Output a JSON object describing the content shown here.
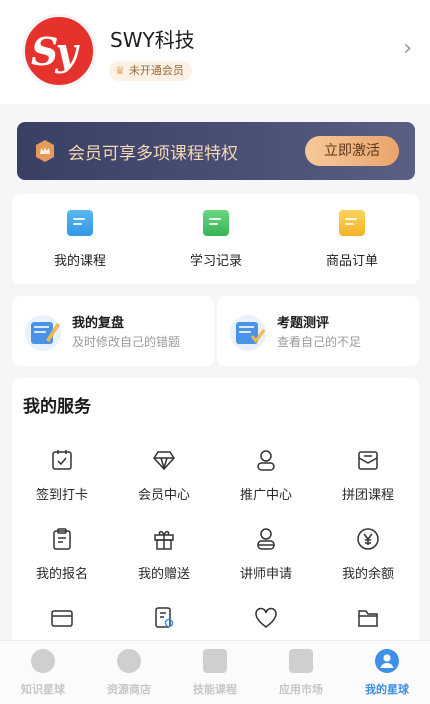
{
  "profile": {
    "avatar_text": "Sy",
    "name": "SWY科技",
    "vip_status": "未开通会员"
  },
  "banner": {
    "text": "会员可享多项课程特权",
    "button": "立即激活"
  },
  "quick_actions": [
    {
      "label": "我的课程",
      "icon": "course-icon"
    },
    {
      "label": "学习记录",
      "icon": "record-icon"
    },
    {
      "label": "商品订单",
      "icon": "order-icon"
    }
  ],
  "review_cards": [
    {
      "title": "我的复盘",
      "subtitle": "及时修改自己的错题"
    },
    {
      "title": "考题测评",
      "subtitle": "查看自己的不足"
    }
  ],
  "services": {
    "title": "我的服务",
    "items": [
      {
        "label": "签到打卡",
        "icon": "calendar-check-icon"
      },
      {
        "label": "会员中心",
        "icon": "diamond-icon"
      },
      {
        "label": "推广中心",
        "icon": "user-icon"
      },
      {
        "label": "拼团课程",
        "icon": "envelope-icon"
      },
      {
        "label": "我的报名",
        "icon": "clipboard-icon"
      },
      {
        "label": "我的赠送",
        "icon": "gift-icon"
      },
      {
        "label": "讲师申请",
        "icon": "teacher-icon"
      },
      {
        "label": "我的余额",
        "icon": "yen-icon"
      },
      {
        "label": "",
        "icon": "card-icon"
      },
      {
        "label": "",
        "icon": "certificate-icon"
      },
      {
        "label": "",
        "icon": "heart-icon"
      },
      {
        "label": "",
        "icon": "folder-icon"
      }
    ]
  },
  "tabbar": [
    {
      "label": "知识星球",
      "active": false
    },
    {
      "label": "资源商店",
      "active": false
    },
    {
      "label": "技能课程",
      "active": false
    },
    {
      "label": "应用市场",
      "active": false
    },
    {
      "label": "我的星球",
      "active": true
    }
  ],
  "colors": {
    "brand_red": "#e5322d",
    "banner_bg": "#3a3f64",
    "banner_text": "#f4d9b3",
    "accent_blue": "#3d8fe8"
  }
}
